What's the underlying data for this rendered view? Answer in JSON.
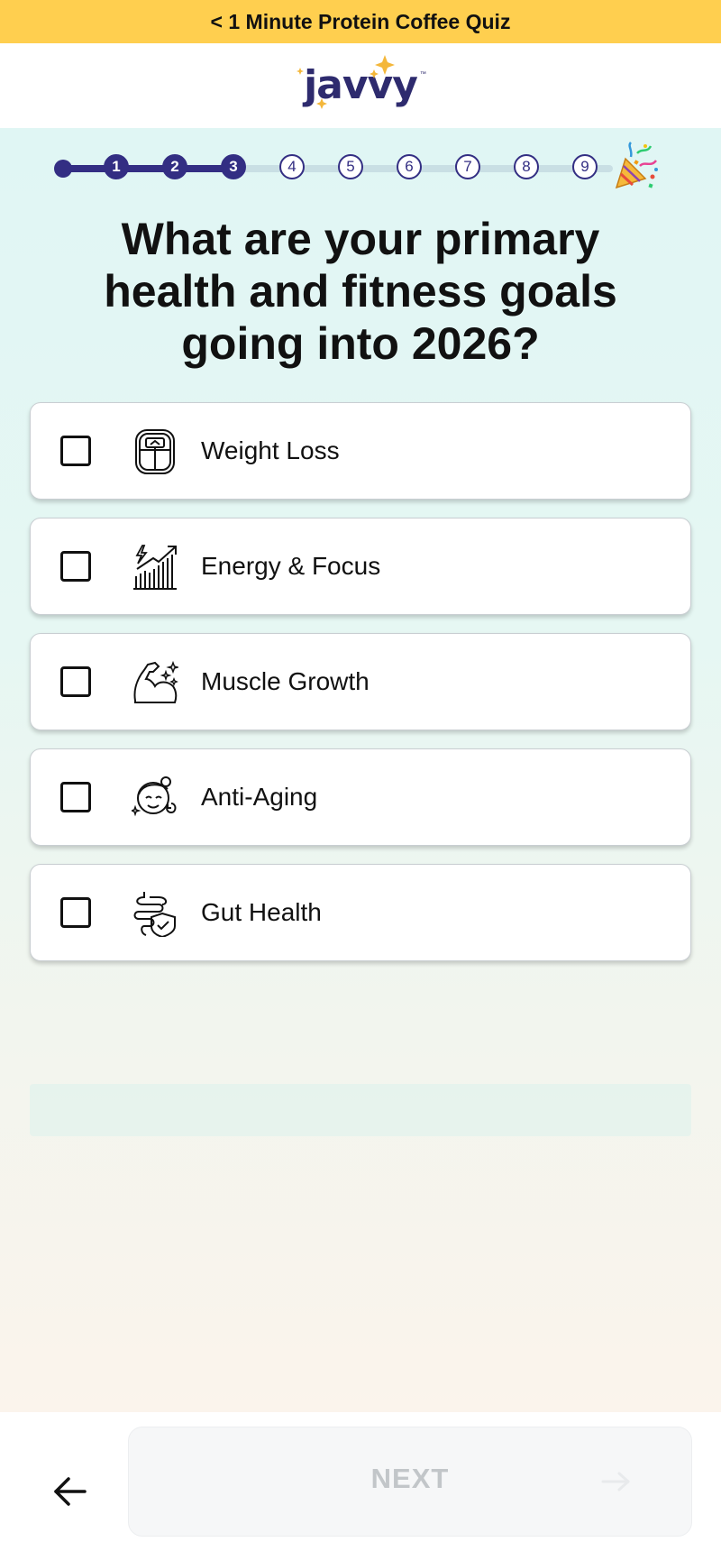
{
  "banner": {
    "text": "< 1 Minute Protein Coffee Quiz"
  },
  "logo": {
    "text": "javvy",
    "tm": "™"
  },
  "progress": {
    "current_step": 3,
    "total_steps": 9,
    "steps": [
      "1",
      "2",
      "3",
      "4",
      "5",
      "6",
      "7",
      "8",
      "9"
    ],
    "final_icon": "party-popper-icon"
  },
  "question": "What are your primary health and fitness goals going into 2026?",
  "options": [
    {
      "label": "Weight Loss",
      "icon": "scale-icon",
      "checked": false
    },
    {
      "label": "Energy & Focus",
      "icon": "energy-chart-icon",
      "checked": false
    },
    {
      "label": "Muscle Growth",
      "icon": "flexed-arm-icon",
      "checked": false
    },
    {
      "label": "Anti-Aging",
      "icon": "face-sparkle-icon",
      "checked": false
    },
    {
      "label": "Gut Health",
      "icon": "intestine-shield-icon",
      "checked": false
    }
  ],
  "footer": {
    "back_icon": "arrow-left-icon",
    "next_label": "NEXT",
    "next_icon": "arrow-right-icon"
  },
  "colors": {
    "banner": "#ffcf4f",
    "brand": "#332e83",
    "accent_star": "#f4b73a",
    "next_disabled_text": "#c2c6c9"
  }
}
